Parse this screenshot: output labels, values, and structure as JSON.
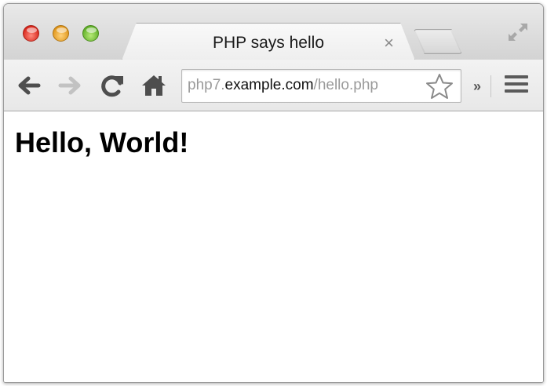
{
  "tab": {
    "title": "PHP says hello",
    "close_glyph": "×"
  },
  "titlebar": {
    "buttons": [
      "close",
      "minimize",
      "zoom"
    ],
    "fullscreen_icon": "fullscreen-arrows-icon"
  },
  "toolbar": {
    "icons": {
      "back": "back-arrow-icon",
      "forward": "forward-arrow-icon",
      "reload": "reload-icon",
      "home": "home-icon",
      "bookmark": "star-icon",
      "menu": "hamburger-menu-icon"
    },
    "overflow_label": "»"
  },
  "address": {
    "subdomain": "php7.",
    "host": "example.com",
    "path": "/hello.php"
  },
  "page": {
    "heading": "Hello, World!"
  },
  "colors": {
    "close": "#d8261b",
    "minimize": "#e0961b",
    "zoom": "#62b12a",
    "url_dim": "#9a9a9a",
    "url_host": "#111111"
  }
}
